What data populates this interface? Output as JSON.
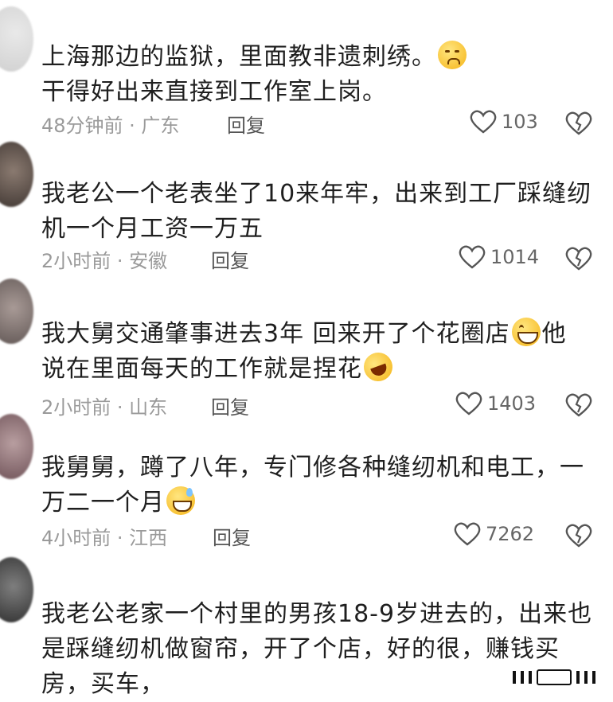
{
  "comments": [
    {
      "line1": "上海那边的监狱，里面教非遗刺绣。",
      "emoji1": "crying-face-emoji",
      "line2": "干得好出来直接到工作室上岗。",
      "time": "48分钟前 · 广东",
      "reply": "回复",
      "likes": "103"
    },
    {
      "line1": "我老公一个老表坐了10来年牢，出来到工厂踩缝纫",
      "line2": "机一个月工资一万五",
      "time": "2小时前 · 安徽",
      "reply": "回复",
      "likes": "1014"
    },
    {
      "line1a": "我大舅交通肇事进去3年 回来开了个花圈店",
      "emoji1": "grinning-face-emoji",
      "line1b": "他",
      "line2": "说在里面每天的工作就是捏花",
      "emoji2": "rolling-laughing-emoji",
      "time": "2小时前 · 山东",
      "reply": "回复",
      "likes": "1403"
    },
    {
      "line1": "我舅舅，蹲了八年，专门修各种缝纫机和电工，一",
      "line2": "万二一个月",
      "emoji1": "grinning-sweat-emoji",
      "time": "4小时前 · 江西",
      "reply": "回复",
      "likes": "7262"
    },
    {
      "line1": "我老公老家一个村里的男孩18-9岁进去的，出来也",
      "line2": "是踩缝纫机做窗帘，开了个店，好的很，赚钱买",
      "line3": "房，买车，"
    }
  ],
  "colors": {
    "text": "#1f1f1f",
    "meta": "#9a9a9a",
    "icon": "#555555"
  }
}
